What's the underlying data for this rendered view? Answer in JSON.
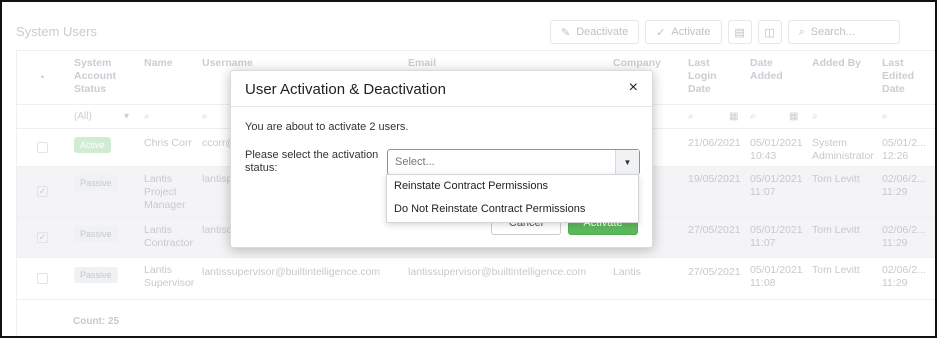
{
  "page": {
    "title": "System Users",
    "count_label": "Count: 25"
  },
  "toolbar": {
    "deactivate_label": "Deactivate",
    "activate_label": "Activate",
    "search_placeholder": "Search..."
  },
  "grid": {
    "headers": [
      "System Account Status",
      "Name",
      "Username",
      "Email",
      "Company",
      "Last Login Date",
      "Date Added",
      "Added By",
      "Last Edited Date"
    ],
    "filter_all": "(All)",
    "rows": [
      {
        "status": "Active",
        "name": "Chris Corr",
        "username": "ccorr@",
        "email": "",
        "company": "...ce",
        "last_login": "21/06/2021",
        "date_added": "05/01/2021 10:43",
        "added_by": "System Administrator",
        "last_edited": "05/01/2... 12:26",
        "selected": false
      },
      {
        "status": "Passive",
        "name": "Lantis Project Manager",
        "username": "lantisp",
        "email": "",
        "company": "",
        "last_login": "19/05/2021",
        "date_added": "05/01/2021 11:07",
        "added_by": "Tom Levitt",
        "last_edited": "02/06/2... 11:29",
        "selected": true
      },
      {
        "status": "Passive",
        "name": "Lantis Contractor",
        "username": "lantisc",
        "email": "",
        "company": "",
        "last_login": "27/05/2021",
        "date_added": "05/01/2021 11:07",
        "added_by": "Tom Levitt",
        "last_edited": "02/06/2... 11:29",
        "selected": true
      },
      {
        "status": "Passive",
        "name": "Lantis Supervisor",
        "username": "lantissupervisor@builtintelligence.com",
        "email": "lantissupervisor@builtintelligence.com",
        "company": "Lantis",
        "last_login": "27/05/2021",
        "date_added": "05/01/2021 11:08",
        "added_by": "Tom Levitt",
        "last_edited": "02/06/2... 11:29",
        "selected": false
      }
    ]
  },
  "modal": {
    "title": "User Activation & Deactivation",
    "close_glyph": "×",
    "message": "You are about to activate 2 users.",
    "select_label": "Please select the activation status:",
    "select_placeholder": "Select...",
    "options": [
      "Reinstate Contract Permissions",
      "Do Not Reinstate Contract Permissions"
    ],
    "cancel_label": "Cancel",
    "activate_label": "Activate"
  },
  "colors": {
    "activate_green": "#5cb85c",
    "focus_blue": "#5aa0e0"
  }
}
